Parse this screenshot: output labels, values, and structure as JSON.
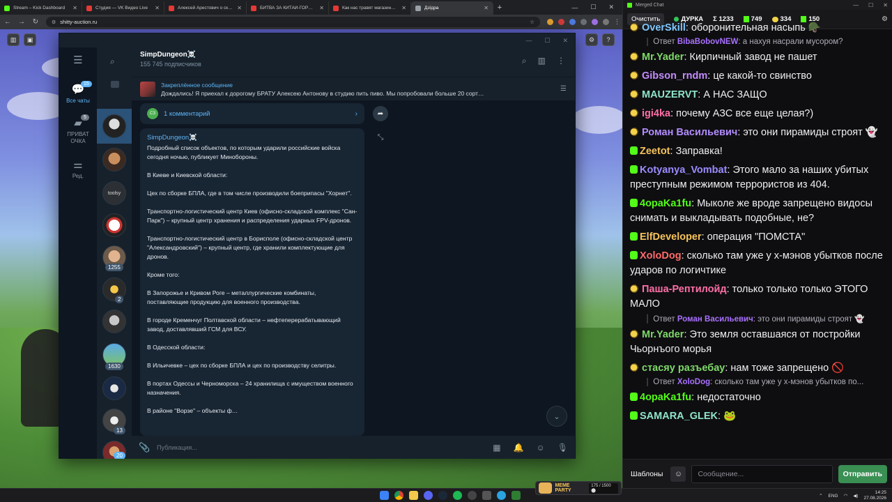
{
  "browser": {
    "tabs": [
      {
        "title": "Stream – Kick Dashboard",
        "color": "#53fc18"
      },
      {
        "title": "Студия — VK Видео Live",
        "color": "#e53935"
      },
      {
        "title": "Алексей Арестович о скандале…",
        "color": "#e53935"
      },
      {
        "title": "БИТВА ЗА КИТАЙ-ГОРОД: НЕ…",
        "color": "#e53935"
      },
      {
        "title": "Как нас травят магазины: Все…",
        "color": "#e53935"
      },
      {
        "title": "Дзїдра",
        "color": "#9aa0a6"
      }
    ],
    "url": "shitty-auction.ru"
  },
  "telegram": {
    "rail": [
      {
        "label": "Все чаты",
        "badge": "15",
        "icon": "chat-bubbles-icon"
      },
      {
        "label": "ПРИВАТ ОЧКА",
        "badge": "5",
        "icon": "folder-icon"
      },
      {
        "label": "Ред.",
        "badge": "",
        "icon": "sliders-icon"
      }
    ],
    "chat_badges": [
      "1255",
      "2",
      "1630",
      "13",
      "20"
    ],
    "channel_name": "SimpDungeon☠️",
    "subscribers": "155 745 подписчиков",
    "pinned_title": "Закреплённое сообщение",
    "pinned_text": "Дождались!   Я приехал к дорогому БРАТУ Алексею Антонову в студию пить пиво. Мы попробовали больше 20 сорт…",
    "comments": "1 комментарий",
    "comment_avatar": "СЗ",
    "post_author": "SimpDungeon☠️",
    "post_paragraphs": [
      "Подробный список объектов, по которым ударили российские войска сегодня ночью, публикует Минобороны.",
      "В Киеве и Киевской области:",
      "Цех по сборке БПЛА, где в том числе производили боеприпасы \"Хорнет\".",
      "Транспортно-логистический центр Киев (офисно-складской комплекс \"Сан-Парк\") – крупный центр хранения и распределения ударных FPV-дронов.",
      "Транспортно-логистический центр в Борисполе (офисно-складской центр \"Александровский\") – крупный центр, где хранили комплектующие для дронов.",
      "Кроме того:",
      "В Запорожье и Кривом Роге – металлургические комбинаты, поставляющие продукцию для военного производства.",
      "В городе Кременчуг Полтавской области – нефтеперерабатывающий завод, доставлявший ГСМ для ВСУ.",
      "В Одесской области:",
      "В Ильичевке – цех по сборке БПЛА и цех по производству селитры.",
      "В портах Одессы и Черноморска – 24 хранилища с имуществом военного назначения.",
      "В районе \"Ворзе\" – объекты ф…"
    ],
    "composer_placeholder": "Публикация..."
  },
  "chat": {
    "window_title": "Merged Chat",
    "clear_label": "Очистить",
    "stats": [
      {
        "label": "ДУРКА",
        "icon": "live-dot"
      },
      {
        "label": "Σ 1233",
        "icon": ""
      },
      {
        "label": "749",
        "icon": "kick-icon"
      },
      {
        "label": "334",
        "icon": "bee-icon"
      },
      {
        "label": "150",
        "icon": "kick-icon"
      }
    ],
    "messages": [
      {
        "type": "msg",
        "platform": "bee",
        "user": "OverSkill",
        "color": "#7ec7ff",
        "text": "оборонительная насыпь 🪖"
      },
      {
        "type": "reply",
        "prefix": "Ответ",
        "user": "BibaBobovNEW",
        "text": "а нахуя насрали мусором?"
      },
      {
        "type": "msg",
        "platform": "bee",
        "user": "Mr.Yader",
        "color": "#7fd86a",
        "text": "Кирпичный завод не пашет"
      },
      {
        "type": "msg",
        "platform": "bee",
        "user": "Gibson_rndm",
        "color": "#c58cff",
        "text": "це какой-то свинство"
      },
      {
        "type": "msg",
        "platform": "bee",
        "user": "MAUZERVT",
        "color": "#8fe3c8",
        "text": "А НАС ЗАЩО"
      },
      {
        "type": "msg",
        "platform": "bee",
        "user": "igi4ka",
        "color": "#ff6fa8",
        "text": "почему АЗС все еще целая?)"
      },
      {
        "type": "msg",
        "platform": "bee",
        "user": "Роман Васильевич",
        "color": "#b28cff",
        "text": "это они пирамиды строят 👻"
      },
      {
        "type": "msg",
        "platform": "kick",
        "user": "Zeetot",
        "color": "#f6c35b",
        "text": "Заправка!"
      },
      {
        "type": "msg",
        "platform": "kick",
        "user": "Kotyanya_Vombat",
        "color": "#9a8cff",
        "text": "Этого мало за наших убитых преступным режимом террористов из 404."
      },
      {
        "type": "msg",
        "platform": "kick",
        "user": "4opaKa1fu",
        "color": "#53fc18",
        "text": "Мыколе же вроде запрещено видосы снимать и выкладывать подобные, не?"
      },
      {
        "type": "msg",
        "platform": "kick",
        "user": "ElfDeveloper",
        "color": "#f6c35b",
        "text": "операция \"ПОМСТА\""
      },
      {
        "type": "msg",
        "platform": "kick",
        "user": "XoloDog",
        "color": "#ff6b6b",
        "text": "сколько там уже у х-мэнов убытков после ударов по логичтике"
      },
      {
        "type": "msg",
        "platform": "bee",
        "user": "Паша-Рептилойд",
        "color": "#ff6fa8",
        "text": "только только только ЭТОГО МАЛО"
      },
      {
        "type": "reply",
        "prefix": "Ответ",
        "user": "Роман Васильевич",
        "text": "это они пирамиды строят 👻"
      },
      {
        "type": "msg",
        "platform": "bee",
        "user": "Mr.Yader",
        "color": "#7fd86a",
        "text": "Это земля оставшаяся от постройки Чьорнъого морья"
      },
      {
        "type": "msg",
        "platform": "bee",
        "user": "стасяу разъебау",
        "color": "#7fd86a",
        "text": "нам тоже запрещено 🚫"
      },
      {
        "type": "reply",
        "prefix": "Ответ",
        "user": "XoloDog",
        "text": "сколько там уже у х-мэнов убытков по..."
      },
      {
        "type": "msg",
        "platform": "kick",
        "user": "4opaKa1fu",
        "color": "#53fc18",
        "text": "недостаточно"
      },
      {
        "type": "msg",
        "platform": "kick",
        "user": "SAMARA_GLEK",
        "color": "#8fe3c8",
        "text": "🐸"
      }
    ],
    "templates_label": "Шаблоны",
    "input_placeholder": "Сообщение...",
    "send_label": "Отправить"
  },
  "overlay": {
    "title": "MEME PARTY",
    "count": "175 / 1500 ⬤"
  },
  "taskbar": {
    "lang": "ENG",
    "time": "14:25",
    "date": "27.08.2026"
  }
}
